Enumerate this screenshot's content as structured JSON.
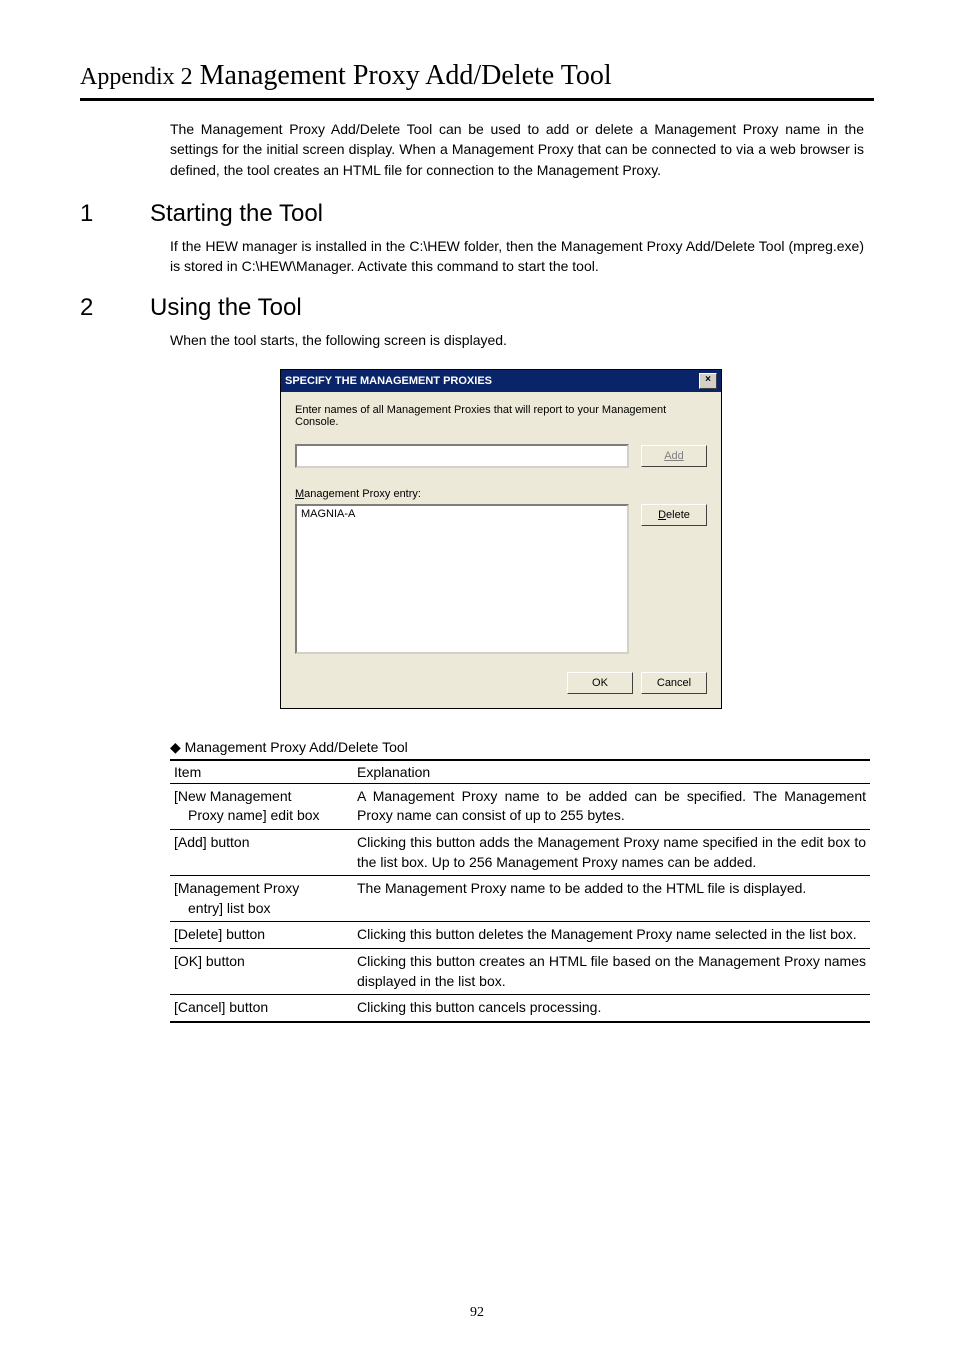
{
  "appendix": {
    "label": "Appendix 2",
    "title": "Management Proxy Add/Delete Tool"
  },
  "intro": "The Management Proxy Add/Delete Tool can be used to add or delete a Management Proxy name in the settings for the initial screen display. When a Management Proxy that can be connected to via a web browser is defined, the tool creates an HTML file for connection to the Management Proxy.",
  "section1": {
    "num": "1",
    "title": "Starting the Tool",
    "body": "If the HEW manager is installed in the C:\\HEW folder, then the Management Proxy Add/Delete Tool (mpreg.exe) is stored in C:\\HEW\\Manager. Activate this command to start the tool."
  },
  "section2": {
    "num": "2",
    "title": "Using the Tool",
    "body": "When the tool starts, the following screen is displayed."
  },
  "dialog": {
    "title": "SPECIFY THE MANAGEMENT PROXIES",
    "close_glyph": "×",
    "instruction": "Enter names of all Management Proxies that will report to your Management Console.",
    "add_label": "Add",
    "entry_label_prefix": "M",
    "entry_label_rest": "anagement Proxy entry:",
    "list_item": "MAGNIA-A",
    "delete_prefix": "D",
    "delete_rest": "elete",
    "ok_label": "OK",
    "cancel_label": "Cancel"
  },
  "table": {
    "caption": "◆ Management Proxy Add/Delete Tool",
    "header_item": "Item",
    "header_expl": "Explanation",
    "rows": [
      {
        "item_line1": "[New Management",
        "item_line2": "Proxy name] edit box",
        "expl": "A Management Proxy name to be added can be specified.\nThe Management Proxy name can consist of up to 255 bytes."
      },
      {
        "item_line1": "[Add] button",
        "item_line2": "",
        "expl": "Clicking this button adds the Management Proxy name specified in the edit box to the list box. Up to 256 Management Proxy names can be added."
      },
      {
        "item_line1": "[Management Proxy",
        "item_line2": "entry] list box",
        "expl": "The Management Proxy name to be added to the HTML file is displayed."
      },
      {
        "item_line1": "[Delete] button",
        "item_line2": "",
        "expl": "Clicking this button deletes the Management Proxy name selected in the list box."
      },
      {
        "item_line1": "[OK] button",
        "item_line2": "",
        "expl": "Clicking this button creates an HTML file based on the Management Proxy names displayed in the list box."
      },
      {
        "item_line1": "[Cancel] button",
        "item_line2": "",
        "expl": "Clicking this button cancels processing."
      }
    ]
  },
  "page_number": "92"
}
